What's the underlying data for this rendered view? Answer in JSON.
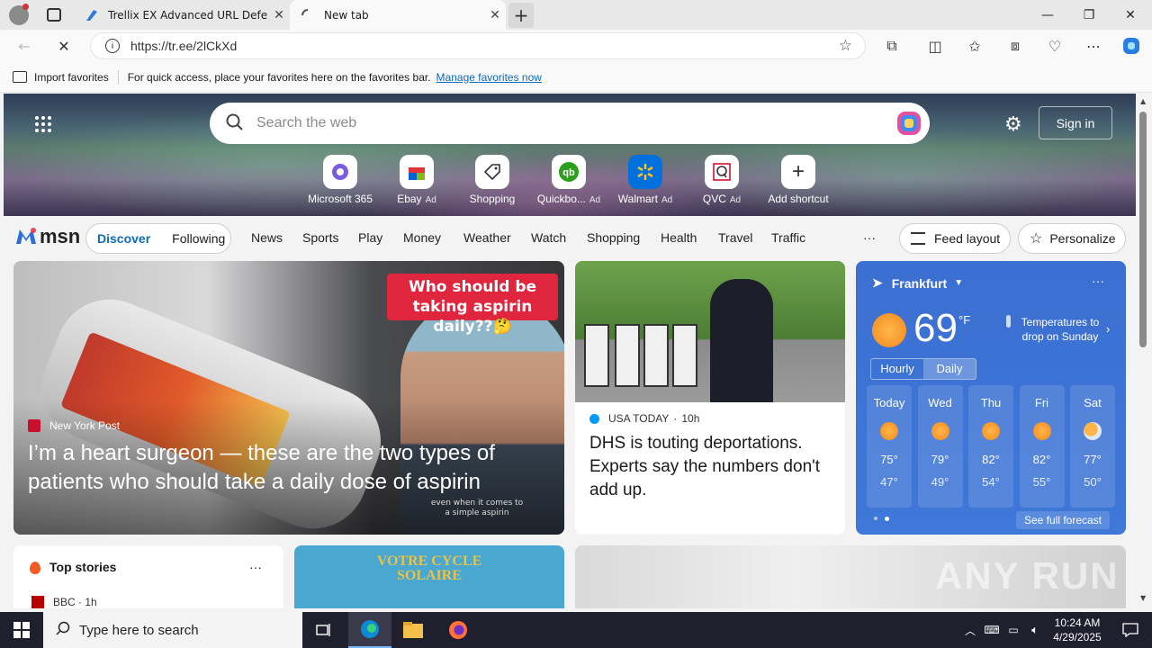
{
  "tabs": [
    {
      "label": "Trellix EX Advanced URL Defense",
      "active": false
    },
    {
      "label": "New tab",
      "active": true
    }
  ],
  "address": {
    "url": "https://tr.ee/2lCkXd"
  },
  "favorites_bar": {
    "import_label": "Import favorites",
    "hint": "For quick access, place your favorites here on the favorites bar.",
    "manage_link": "Manage favorites now"
  },
  "search": {
    "placeholder": "Search the web",
    "signin": "Sign in"
  },
  "quick_links": [
    {
      "label": "Microsoft 365",
      "ad": ""
    },
    {
      "label": "Ebay",
      "ad": "Ad"
    },
    {
      "label": "Shopping",
      "ad": ""
    },
    {
      "label": "Quickbo...",
      "ad": "Ad"
    },
    {
      "label": "Walmart",
      "ad": "Ad"
    },
    {
      "label": "QVC",
      "ad": "Ad"
    },
    {
      "label": "Add shortcut",
      "ad": ""
    }
  ],
  "msn": {
    "logo": "msn",
    "discover": "Discover",
    "following": "Following",
    "nav": [
      "News",
      "Sports",
      "Play",
      "Money",
      "Weather",
      "Watch",
      "Shopping",
      "Health",
      "Travel",
      "Traffic"
    ],
    "more": "···",
    "feed_layout": "Feed layout",
    "personalize": "Personalize"
  },
  "main_card": {
    "banner": "Who should be taking aspirin daily??🤔",
    "source": "New York Post",
    "headline": "I’m a heart surgeon — these are the two types of patients who should take a daily dose of aspirin",
    "caption": "even when it comes to a simple aspirin"
  },
  "dhs_card": {
    "source": "USA TODAY",
    "age": "10h",
    "headline": "DHS is touting deportations. Experts say the numbers don't add up."
  },
  "weather": {
    "location": "Frankfurt",
    "temp": "69",
    "unit": "°F",
    "alert": "Temperatures to drop on Sunday",
    "tab_hourly": "Hourly",
    "tab_daily": "Daily",
    "days": [
      {
        "day": "Today",
        "high": "75°",
        "low": "47°",
        "icon": "sunny-icon"
      },
      {
        "day": "Wed",
        "high": "79°",
        "low": "49°",
        "icon": "sunny-icon"
      },
      {
        "day": "Thu",
        "high": "82°",
        "low": "54°",
        "icon": "sunny-icon"
      },
      {
        "day": "Fri",
        "high": "82°",
        "low": "55°",
        "icon": "sunny-icon"
      },
      {
        "day": "Sat",
        "high": "77°",
        "low": "50°",
        "icon": "partly-cloudy-icon"
      }
    ],
    "forecast_link": "See full forecast"
  },
  "top_stories": {
    "title": "Top stories",
    "source": "BBC",
    "age": "1h"
  },
  "solaire": {
    "title": "VOTRE CYCLE SOLAIRE"
  },
  "watermark": "ANY RUN",
  "taskbar": {
    "search_placeholder": "Type here to search",
    "time": "10:24 AM",
    "date": "4/29/2025"
  },
  "colors": {
    "accent": "#0f6cbd",
    "weather_bg": "#3b6fd1",
    "taskbar": "#1f1f2e"
  }
}
